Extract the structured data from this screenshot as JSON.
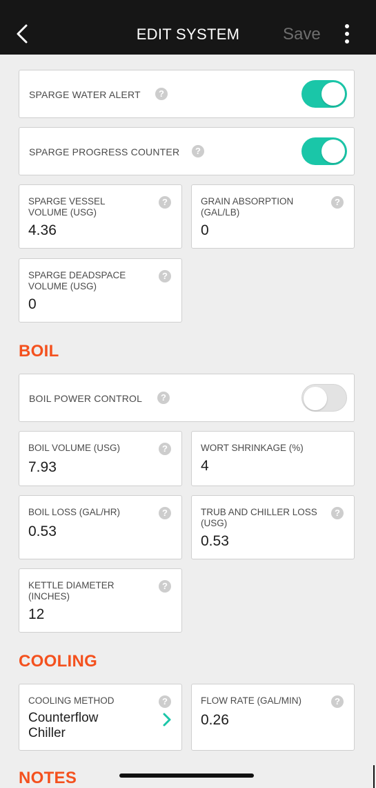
{
  "header": {
    "title": "EDIT SYSTEM",
    "save_label": "Save",
    "back_icon": "chevron-left-icon",
    "more_icon": "more-vertical-icon"
  },
  "colors": {
    "header_bg": "#161616",
    "accent": "#1ac6a8",
    "section_title": "#f4511e",
    "background": "#eeeeee"
  },
  "sparge": {
    "water_alert": {
      "label": "SPARGE WATER ALERT",
      "enabled": true
    },
    "progress_counter": {
      "label": "SPARGE PROGRESS COUNTER",
      "enabled": true
    },
    "vessel_volume": {
      "label": "SPARGE VESSEL VOLUME (USG)",
      "value": "4.36"
    },
    "grain_absorption": {
      "label": "GRAIN ABSORPTION (GAL/LB)",
      "value": "0"
    },
    "deadspace_volume": {
      "label": "SPARGE DEADSPACE VOLUME (USG)",
      "value": "0"
    }
  },
  "boil": {
    "title": "BOIL",
    "power_control": {
      "label": "BOIL POWER CONTROL",
      "enabled": false
    },
    "boil_volume": {
      "label": "BOIL VOLUME (USG)",
      "value": "7.93"
    },
    "wort_shrinkage": {
      "label": "WORT SHRINKAGE (%)",
      "value": "4"
    },
    "boil_loss": {
      "label": "BOIL LOSS (GAL/HR)",
      "value": "0.53"
    },
    "trub_chiller_loss": {
      "label": "TRUB AND CHILLER LOSS (USG)",
      "value": "0.53"
    },
    "kettle_diameter": {
      "label": "KETTLE DIAMETER (INCHES)",
      "value": "12"
    }
  },
  "cooling": {
    "title": "COOLING",
    "method": {
      "label": "COOLING METHOD",
      "value_line1": "Counterflow",
      "value_line2": "Chiller"
    },
    "flow_rate": {
      "label": "FLOW RATE (GAL/MIN)",
      "value": "0.26"
    }
  },
  "notes": {
    "title": "NOTES"
  },
  "help_glyph": "?"
}
